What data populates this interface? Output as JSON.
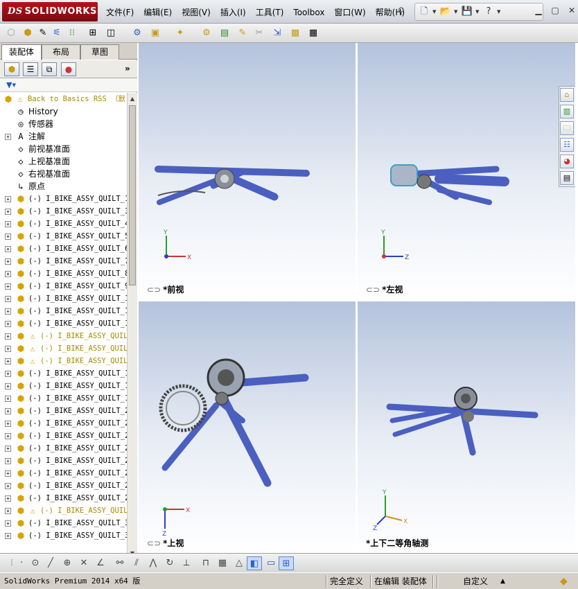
{
  "app": {
    "brand_prefix": "DS",
    "brand_name": "SOLIDWORKS"
  },
  "menu": [
    "文件(F)",
    "编辑(E)",
    "视图(V)",
    "插入(I)",
    "工具(T)",
    "Toolbox",
    "窗口(W)",
    "帮助(H)"
  ],
  "std_icons": [
    "new-document-icon",
    "open-folder-icon",
    "save-icon",
    "help-icon",
    "minimize-icon",
    "restore-icon",
    "close-icon"
  ],
  "tabs": [
    "装配体",
    "布局",
    "草图"
  ],
  "tree": {
    "root": "Back to Basics RSS （默",
    "features": [
      "History",
      "传感器",
      "注解",
      "前视基准面",
      "上视基准面",
      "右视基准面",
      "原点"
    ],
    "items": [
      {
        "label": "(-) I_BIKE_ASSY_QUILT_1",
        "warn": false
      },
      {
        "label": "(-) I_BIKE_ASSY_QUILT_3",
        "warn": false
      },
      {
        "label": "(-) I_BIKE_ASSY_QUILT_4",
        "warn": false
      },
      {
        "label": "(-) I_BIKE_ASSY_QUILT_5",
        "warn": false
      },
      {
        "label": "(-) I_BIKE_ASSY_QUILT_6",
        "warn": false
      },
      {
        "label": "(-) I_BIKE_ASSY_QUILT_7",
        "warn": false
      },
      {
        "label": "(-) I_BIKE_ASSY_QUILT_8",
        "warn": false
      },
      {
        "label": "(-) I_BIKE_ASSY_QUILT_9",
        "warn": false
      },
      {
        "label": "(-) I_BIKE_ASSY_QUILT_1",
        "warn": false
      },
      {
        "label": "(-) I_BIKE_ASSY_QUILT_1",
        "warn": false
      },
      {
        "label": "(-) I_BIKE_ASSY_QUILT_1",
        "warn": false
      },
      {
        "label": "(-) I_BIKE_ASSY_QUIL",
        "warn": true
      },
      {
        "label": "(-) I_BIKE_ASSY_QUIL",
        "warn": true
      },
      {
        "label": "(-) I_BIKE_ASSY_QUIL",
        "warn": true
      },
      {
        "label": "(-) I_BIKE_ASSY_QUILT_1",
        "warn": false
      },
      {
        "label": "(-) I_BIKE_ASSY_QUILT_1",
        "warn": false
      },
      {
        "label": "(-) I_BIKE_ASSY_QUILT_1",
        "warn": false
      },
      {
        "label": "(-) I_BIKE_ASSY_QUILT_2",
        "warn": false
      },
      {
        "label": "(-) I_BIKE_ASSY_QUILT_2",
        "warn": false
      },
      {
        "label": "(-) I_BIKE_ASSY_QUILT_2",
        "warn": false
      },
      {
        "label": "(-) I_BIKE_ASSY_QUILT_2",
        "warn": false
      },
      {
        "label": "(-) I_BIKE_ASSY_QUILT_2",
        "warn": false
      },
      {
        "label": "(-) I_BIKE_ASSY_QUILT_2",
        "warn": false
      },
      {
        "label": "(-) I_BIKE_ASSY_QUILT_2",
        "warn": false
      },
      {
        "label": "(-) I_BIKE_ASSY_QUILT_2",
        "warn": false
      },
      {
        "label": "(-) I_BIKE_ASSY_QUIL",
        "warn": true
      },
      {
        "label": "(-) I_BIKE_ASSY_QUILT_3",
        "warn": false
      },
      {
        "label": "(-) I_BIKE_ASSY_QUILT_3",
        "warn": false
      }
    ]
  },
  "viewports": [
    {
      "label": "*前视",
      "axes": [
        "Y",
        "X"
      ]
    },
    {
      "label": "*左视",
      "axes": [
        "Y",
        "Z"
      ]
    },
    {
      "label": "*上视",
      "axes": [
        "X",
        "Z"
      ]
    },
    {
      "label": "*上下二等角轴测",
      "axes": [
        "Y",
        "X",
        "Z"
      ]
    }
  ],
  "status": {
    "product": "SolidWorks Premium 2014 x64 版",
    "definition": "完全定义",
    "mode": "在编辑 装配体",
    "units": "自定义",
    "units_arrow": "▲"
  },
  "colors": {
    "brand_red": "#b6121b",
    "part_yellow": "#d7a300",
    "tube_blue": "#4a5fc0",
    "warn_text": "#a58a00"
  }
}
